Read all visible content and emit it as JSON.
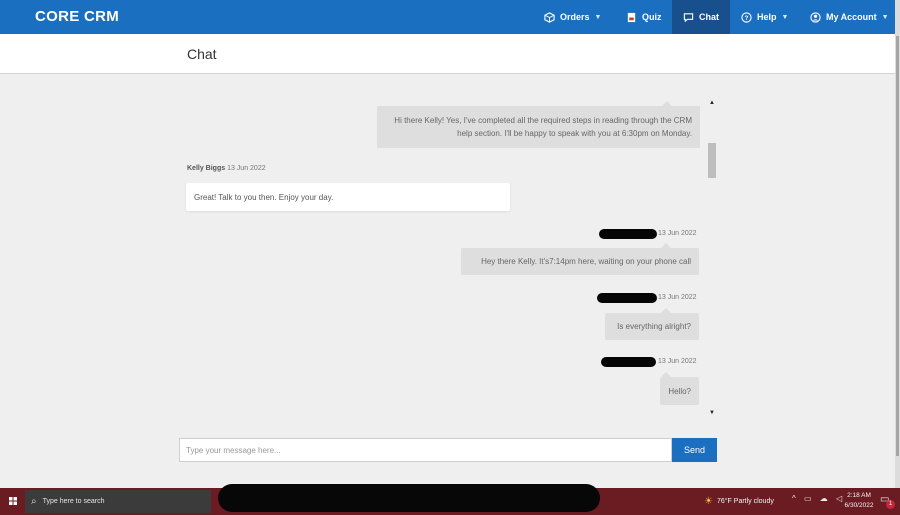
{
  "app": {
    "brand": "CORE CRM",
    "accent_color": "#1a6fc0"
  },
  "nav": {
    "orders": {
      "label": "Orders",
      "icon": "box-icon"
    },
    "quiz": {
      "label": "Quiz",
      "icon": "document-icon"
    },
    "chat": {
      "label": "Chat",
      "icon": "chat-bubble-icon"
    },
    "help": {
      "label": "Help",
      "icon": "question-circle-icon"
    },
    "account": {
      "label": "My Account",
      "icon": "user-circle-icon"
    }
  },
  "page": {
    "title": "Chat"
  },
  "messages": [
    {
      "direction": "outgoing",
      "sender": "",
      "date": "",
      "text": "Hi there Kelly! Yes, I've completed all the required steps in reading through the CRM help section. I'll be happy to speak with you at 6:30pm on Monday."
    },
    {
      "direction": "incoming",
      "sender": "Kelly Biggs",
      "date": "13 Jun 2022",
      "text": "Great! Talk to you then. Enjoy your day."
    },
    {
      "direction": "outgoing",
      "sender": "[redacted]",
      "date": "13 Jun 2022",
      "text": "Hey there Kelly. It's7:14pm here, waiting on your phone call"
    },
    {
      "direction": "outgoing",
      "sender": "[redacted]",
      "date": "13 Jun 2022",
      "text": "Is everything alright?"
    },
    {
      "direction": "outgoing",
      "sender": "[redacted]",
      "date": "13 Jun 2022",
      "text": "Hello?"
    }
  ],
  "composer": {
    "placeholder": "Type your message here...",
    "send_label": "Send"
  },
  "taskbar": {
    "search_placeholder": "Type here to search",
    "weather": "76°F  Partly cloudy",
    "time": "2:18 AM",
    "date": "6/30/2022",
    "notification_count": "1"
  }
}
